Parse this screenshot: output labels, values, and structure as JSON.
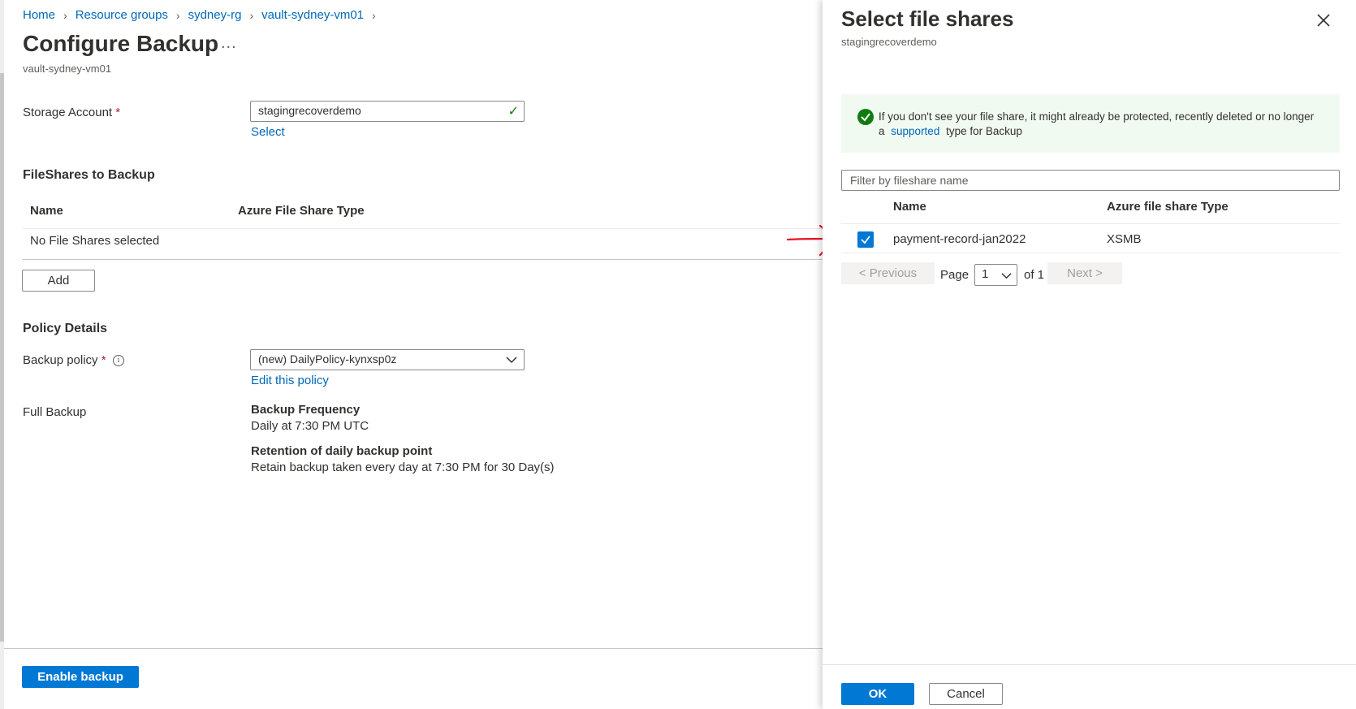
{
  "breadcrumb": [
    "Home",
    "Resource groups",
    "sydney-rg",
    "vault-sydney-vm01"
  ],
  "page": {
    "title": "Configure Backup",
    "subtitle": "vault-sydney-vm01",
    "ellipsis": "..."
  },
  "storage": {
    "label": "Storage Account",
    "value": "stagingrecoverdemo",
    "select_link": "Select"
  },
  "fileshares": {
    "heading": "FileShares to Backup",
    "col_name": "Name",
    "col_type": "Azure File Share Type",
    "empty_text": "No File Shares selected",
    "add_label": "Add"
  },
  "policy": {
    "heading": "Policy Details",
    "label": "Backup policy",
    "value": "(new) DailyPolicy-kynxsp0z",
    "edit_link": "Edit this policy",
    "full_backup_label": "Full Backup",
    "frequency_title": "Backup Frequency",
    "frequency_value": "Daily at 7:30 PM UTC",
    "retention_title": "Retention of daily backup point",
    "retention_value": "Retain backup taken every day at 7:30 PM for 30 Day(s)"
  },
  "enable_backup_label": "Enable backup",
  "panel": {
    "title": "Select file shares",
    "subtitle": "stagingrecoverdemo",
    "info_text_1": "If you don't see your file share, it might already be protected, recently deleted or no longer",
    "info_text_2a": "a",
    "info_link": "supported",
    "info_text_2b": "type for Backup",
    "filter_placeholder": "Filter by fileshare name",
    "col_name": "Name",
    "col_type": "Azure file share Type",
    "rows": [
      {
        "name": "payment-record-jan2022",
        "type": "XSMB",
        "checked": true
      }
    ],
    "pager": {
      "previous": "< Previous",
      "page_label": "Page",
      "page_value": "1",
      "of_label": "of 1",
      "next": "Next >"
    },
    "ok_label": "OK",
    "cancel_label": "Cancel"
  },
  "colors": {
    "accent": "#0078d4",
    "link": "#0067b8",
    "success": "#107c10",
    "annotation_arrow": "#e81123"
  }
}
